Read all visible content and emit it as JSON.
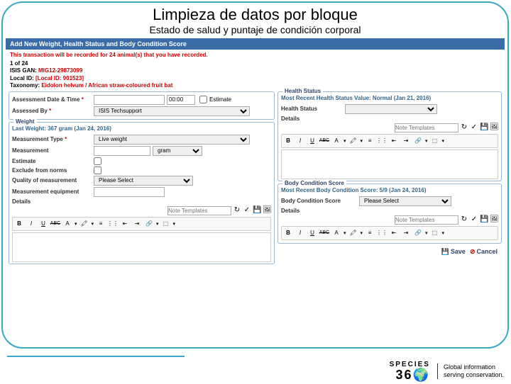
{
  "title": "Limpieza de datos por bloque",
  "subtitle": "Estado de salud y puntaje de condición corporal",
  "app_header": "Add New Weight, Health Status and Body Condition Score",
  "warning": {
    "pre": "This transaction will be recorded for ",
    "count": "24",
    "post": " animal(s) that you have recorded."
  },
  "info": {
    "counter": "1 of 24",
    "isis_label": "ISIS GAN:",
    "isis_val": "MIG12-29873099",
    "local_label": "Local ID:",
    "local_val": "[Local ID: 901523]",
    "tax_label": "Taxonomy:",
    "tax_val": "Eidolon helvum / African straw-coloured fruit bat"
  },
  "assess": {
    "date_lbl": "Assessment Date & Time",
    "date_val": "",
    "time_val": "00:00",
    "est_lbl": "Estimate",
    "by_lbl": "Assessed By",
    "by_val": "ISIS Techsupport"
  },
  "weight": {
    "panel": "Weight",
    "last": "Last Weight: 367 gram (Jan 24, 2016)",
    "type_lbl": "Measurement Type",
    "type_val": "Live weight",
    "meas_lbl": "Measurement",
    "unit": "gram",
    "est_lbl": "Estimate",
    "excl_lbl": "Exclude from norms",
    "qual_lbl": "Quality of measurement",
    "qual_ph": "Please Select",
    "equip_lbl": "Measurement equipment",
    "details_lbl": "Details",
    "note_ph": "Note Templates"
  },
  "health": {
    "panel": "Health Status",
    "recent": "Most Recent Health Status Value: Normal (Jan 21, 2016)",
    "hs_lbl": "Health Status",
    "details_lbl": "Details",
    "note_ph": "Note Templates"
  },
  "bcs": {
    "panel": "Body Condition Score",
    "recent": "Most Recent Body Condition Score: 5/9 (Jan 24, 2016)",
    "bcs_lbl": "Body Condition Score",
    "bcs_ph": "Please Select",
    "details_lbl": "Details",
    "note_ph": "Note Templates"
  },
  "toolbar": {
    "b": "B",
    "i": "I",
    "u": "U",
    "abc": "ABC",
    "a": "A",
    "check": "✓",
    "x": "✗",
    "disk": "💾",
    "img": "🖼"
  },
  "footer": {
    "save": "Save",
    "cancel": "Cancel"
  },
  "brand": {
    "name": "SPECIES",
    "num": "36🌍",
    "tag1": "Global information",
    "tag2": "serving conservation."
  }
}
